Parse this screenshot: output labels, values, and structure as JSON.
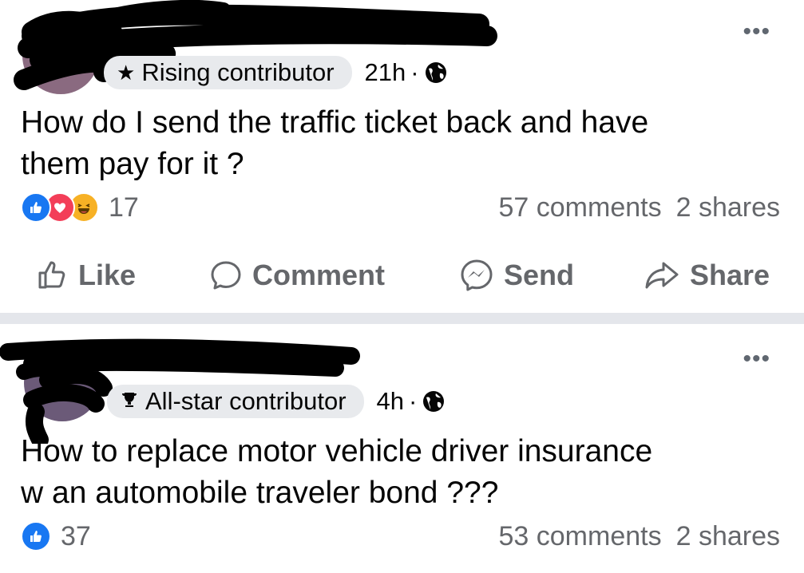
{
  "posts": [
    {
      "badge": "Rising contributor",
      "badge_icon": "star-icon",
      "time": "21h",
      "separator": "·",
      "text_line1": "How do I send the traffic ticket back and have",
      "text_line2": "them pay for it ?",
      "reaction_icons": [
        "like-icon",
        "love-icon",
        "haha-icon"
      ],
      "reaction_count": "17",
      "comments": "57 comments",
      "shares": "2 shares",
      "more": "•••"
    },
    {
      "badge": "All-star contributor",
      "badge_icon": "trophy-icon",
      "time": "4h",
      "separator": "·",
      "text_line1": "How to replace motor vehicle driver insurance",
      "text_line2": "w an automobile traveler bond ???",
      "reaction_icons": [
        "like-icon"
      ],
      "reaction_count": "37",
      "comments": "53 comments",
      "shares": "2 shares",
      "more": "•••"
    }
  ],
  "actions": {
    "like": "Like",
    "comment": "Comment",
    "send": "Send",
    "share": "Share"
  },
  "colors": {
    "like_blue": "#1877f2",
    "love_red": "#f33e58",
    "haha_yellow": "#f7b125",
    "muted_text": "#65676b",
    "separator": "#e4e6eb",
    "redaction": "#000000"
  }
}
